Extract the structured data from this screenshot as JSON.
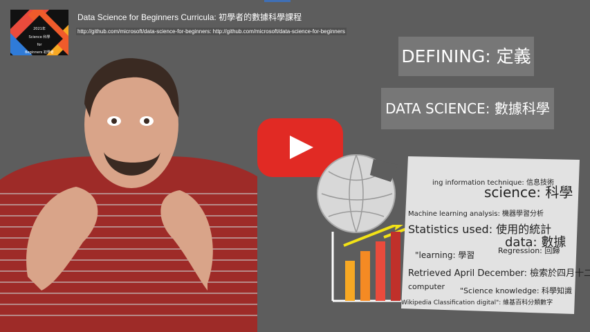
{
  "header": {
    "title": "Data Science for Beginners Curricula: 初學者的數據科學課程",
    "subtitle": "http://github.com/microsoft/data-science-for-beginners: http://github.com/microsoft/data-science-for-beginners"
  },
  "logo": {
    "line1": "2021年",
    "line2": "Science 科學",
    "line3": "for",
    "line4": "Beginners 初學者"
  },
  "labels": {
    "defining": "DEFINING: 定義",
    "data_science": "DATA SCIENCE: 數據科學"
  },
  "word_cloud": {
    "words": [
      "ing information technique: 信息技術",
      "science: 科學",
      "Machine learning analysis: 機器學習分析",
      "Statistics used: 使用的統計",
      "data: 數據",
      "\"learning: 學習",
      "Regression: 回歸",
      "Retrieved April December: 檢索於四月十二月",
      "computer",
      "\"Science knowledge: 科學知識",
      "Wikipedia Classification digital\": 維基百科分類數字"
    ]
  },
  "play": {
    "icon": "play-icon"
  },
  "colors": {
    "play_red": "#e12a24",
    "background": "#5d5d5d"
  }
}
